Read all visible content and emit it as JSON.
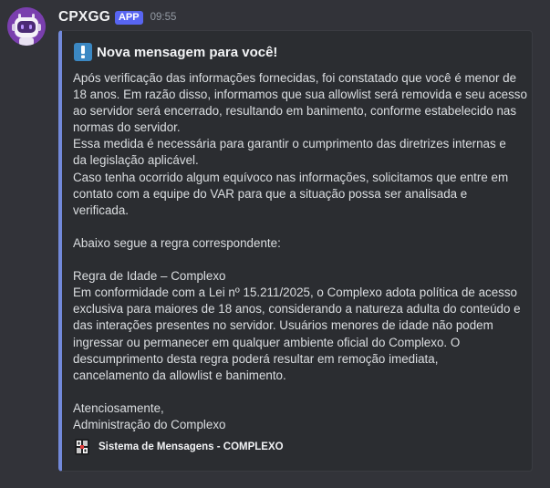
{
  "message": {
    "author": {
      "username": "CPXGG",
      "badge": "APP",
      "avatar_icon": "robot-avatar-icon"
    },
    "timestamp": "09:55"
  },
  "embed": {
    "accent_color": "#7289da",
    "title_icon": "exclamation-icon",
    "title": "Nova mensagem para você!",
    "body_lines": [
      "Após verificação das informações fornecidas, foi constatado que você é menor de",
      "18 anos. Em razão disso, informamos que sua allowlist será removida e seu acesso",
      "ao servidor será encerrado, resultando em banimento, conforme estabelecido nas",
      "normas do servidor.",
      "Essa medida é necessária para garantir o cumprimento das diretrizes internas e",
      "da legislação aplicável.",
      "Caso tenha ocorrido algum equívoco nas informações, solicitamos que entre em",
      "contato com a equipe do VAR para que a situação possa ser analisada e",
      "verificada.",
      "",
      "Abaixo segue a regra correspondente:",
      "",
      "Regra de Idade – Complexo",
      "Em conformidade com a Lei nº 15.211/2025, o Complexo adota política de acesso",
      "exclusiva para maiores de 18 anos, considerando a natureza adulta do conteúdo e",
      "das interações presentes no servidor. Usuários menores de idade não podem",
      "ingressar ou permanecer em qualquer ambiente oficial do Complexo. O",
      "descumprimento desta regra poderá resultar em remoção imediata,",
      "cancelamento da allowlist e banimento.",
      "",
      "Atenciosamente,",
      "Administração do Complexo"
    ],
    "footer": {
      "icon": "complexo-logo-icon",
      "text": "Sistema de Mensagens - COMPLEXO"
    }
  },
  "colors": {
    "background": "#323339",
    "embed_background": "#2b2d31",
    "app_badge": "#5865f2",
    "text": "#dbdee1",
    "timestamp": "#949ba4"
  }
}
